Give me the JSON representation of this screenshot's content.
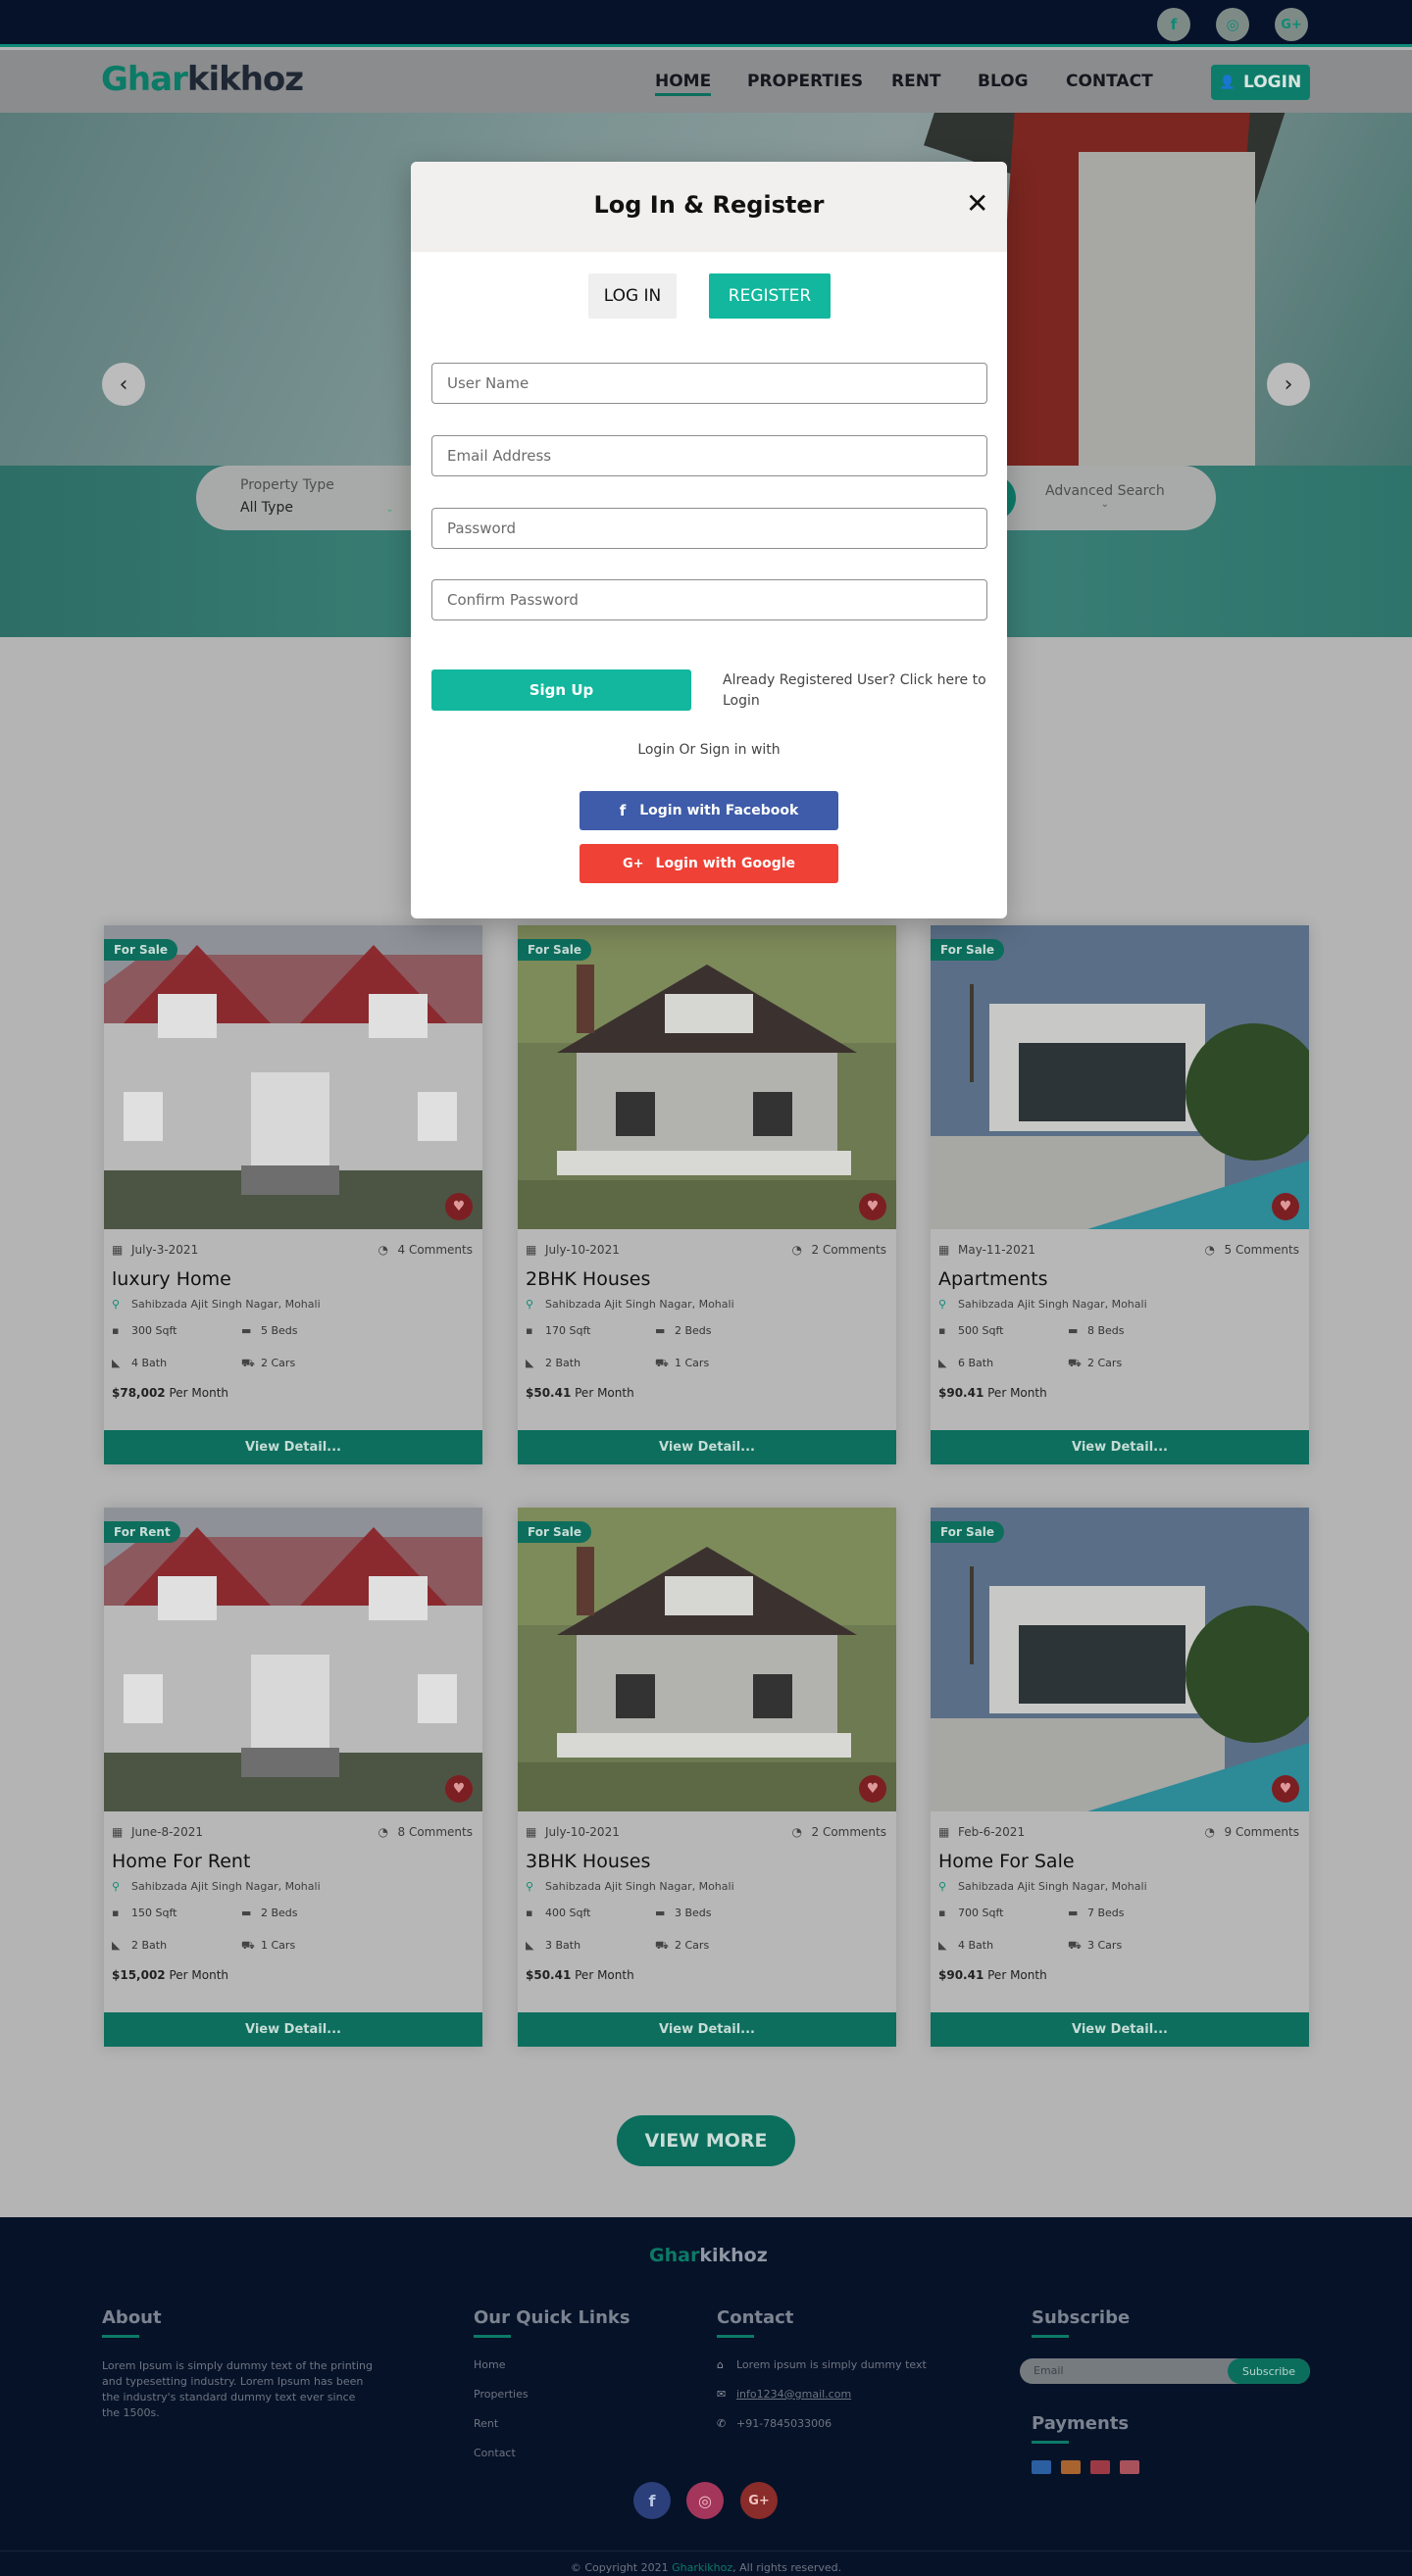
{
  "brand": {
    "first": "G",
    "rest_g": "har",
    "rest": "kikhoz"
  },
  "topbar": {
    "social": [
      {
        "icon": "facebook-icon",
        "glyph": "f"
      },
      {
        "icon": "instagram-icon",
        "glyph": "◎"
      },
      {
        "icon": "google-plus-icon",
        "glyph": "G+"
      }
    ]
  },
  "nav": {
    "items": [
      "HOME",
      "PROPERTIES",
      "RENT",
      "BLOG",
      "CONTACT"
    ],
    "login": "LOGIN"
  },
  "search": {
    "type_label": "Property Type",
    "type_value": "All Type",
    "advanced": "Advanced Search"
  },
  "modal": {
    "title": "Log In & Register",
    "close": "✕",
    "tab_login": "LOG IN",
    "tab_register": "REGISTER",
    "placeholders": {
      "username": "User Name",
      "email": "Email Address",
      "password": "Password",
      "confirm": "Confirm Password"
    },
    "signup": "Sign Up",
    "already": "Already Registered User?  Click here to Login",
    "or": "Login Or Sign in with",
    "facebook": "Login with Facebook",
    "google": "Login with Google"
  },
  "cards": [
    {
      "badge": "For Sale",
      "date": "July-3-2021",
      "comments": "4  Comments",
      "title": "luxury Home",
      "address": "Sahibzada Ajit Singh Nagar, Mohali",
      "area": "300 Sqft",
      "beds": "5 Beds",
      "bath": "4 Bath",
      "cars": "2 Cars",
      "price": "$78,002",
      "per": " Per Month",
      "button": "View Detail..."
    },
    {
      "badge": "For Sale",
      "date": "July-10-2021",
      "comments": "2  Comments",
      "title": "2BHK Houses",
      "address": "Sahibzada Ajit Singh Nagar, Mohali",
      "area": "170 Sqft",
      "beds": "2 Beds",
      "bath": "2 Bath",
      "cars": "1 Cars",
      "price": "$50.41",
      "per": " Per Month",
      "button": "View Detail..."
    },
    {
      "badge": "For Sale",
      "date": "May-11-2021",
      "comments": "5  Comments",
      "title": "Apartments",
      "address": "Sahibzada Ajit Singh Nagar, Mohali",
      "area": "500 Sqft",
      "beds": "8 Beds",
      "bath": "6 Bath",
      "cars": "2 Cars",
      "price": "$90.41",
      "per": " Per Month",
      "button": "View Detail..."
    },
    {
      "badge": "For Rent",
      "date": "June-8-2021",
      "comments": "8  Comments",
      "title": "Home For Rent",
      "address": "Sahibzada Ajit Singh Nagar, Mohali",
      "area": "150 Sqft",
      "beds": "2 Beds",
      "bath": "2 Bath",
      "cars": "1 Cars",
      "price": "$15,002",
      "per": " Per Month",
      "button": "View Detail..."
    },
    {
      "badge": "For Sale",
      "date": "July-10-2021",
      "comments": "2  Comments",
      "title": "3BHK Houses",
      "address": "Sahibzada Ajit Singh Nagar, Mohali",
      "area": "400 Sqft",
      "beds": "3 Beds",
      "bath": "3 Bath",
      "cars": "2 Cars",
      "price": "$50.41",
      "per": " Per Month",
      "button": "View Detail..."
    },
    {
      "badge": "For Sale",
      "date": "Feb-6-2021",
      "comments": "9  Comments",
      "title": "Home For Sale",
      "address": "Sahibzada Ajit Singh Nagar, Mohali",
      "area": "700 Sqft",
      "beds": "7 Beds",
      "bath": "4 Bath",
      "cars": "3 Cars",
      "price": "$90.41",
      "per": " Per Month",
      "button": "View Detail..."
    }
  ],
  "view_more": "VIEW MORE",
  "footer": {
    "about_h": "About",
    "about_text": "Lorem Ipsum is simply dummy text of the printing and typesetting industry. Lorem Ipsum has been the industry's standard dummy text ever since the 1500s.",
    "links_h": "Our Quick Links",
    "links": [
      "Home",
      "Properties",
      "Rent",
      "Contact"
    ],
    "contact_h": "Contact",
    "address": "Lorem ipsum is simply dummy text",
    "email": "info1234@gmail.com",
    "phone": "+91-7845033006",
    "subscribe_h": "Subscribe",
    "email_ph": "Email",
    "subscribe_btn": "Subscribe",
    "payments_h": "Payments",
    "copy_pre": "Copyright 2021 ",
    "copy_brand": "Gharkikhoz",
    "copy_post": ", All rights reserved."
  }
}
